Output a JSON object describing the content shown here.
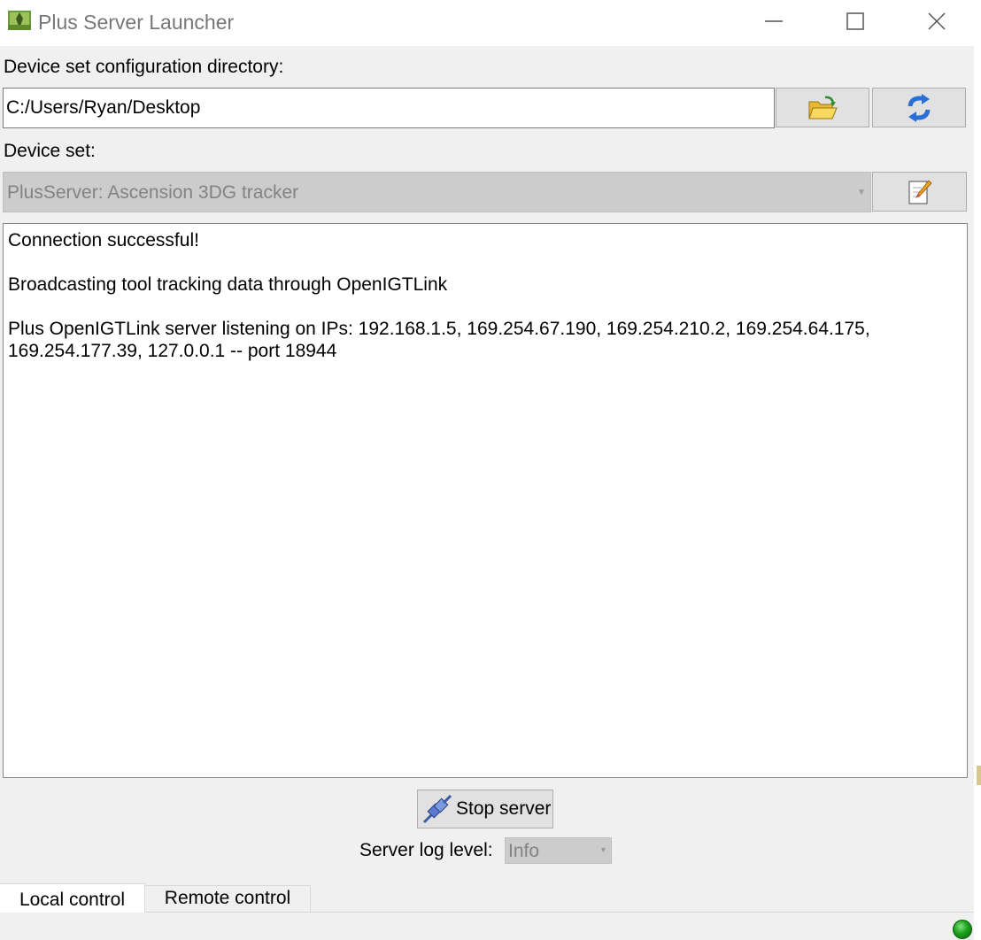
{
  "window": {
    "title": "Plus Server Launcher",
    "controls": [
      "minimize",
      "maximize",
      "close"
    ]
  },
  "config": {
    "directory_label": "Device set configuration directory:",
    "directory_value": "C:/Users/Ryan/Desktop",
    "browse_icon": "open-folder-icon",
    "refresh_icon": "refresh-icon"
  },
  "device_set": {
    "label": "Device set:",
    "selected": "PlusServer: Ascension 3DG tracker",
    "edit_icon": "edit-config-icon"
  },
  "log": {
    "lines": [
      "Connection successful!",
      "Broadcasting tool tracking data through OpenIGTLink",
      "Plus OpenIGTLink server listening on IPs: 192.168.1.5, 169.254.67.190, 169.254.210.2, 169.254.64.175, 169.254.177.39, 127.0.0.1 -- port 18944"
    ]
  },
  "server": {
    "stop_label": "Stop server",
    "stop_icon": "plug-connected-icon",
    "log_level_label": "Server log level:",
    "log_level_value": "Info"
  },
  "tabs": [
    {
      "label": "Local control",
      "active": true
    },
    {
      "label": "Remote control",
      "active": false
    }
  ],
  "status": {
    "indicator": "green",
    "color": "#1aa01a"
  }
}
